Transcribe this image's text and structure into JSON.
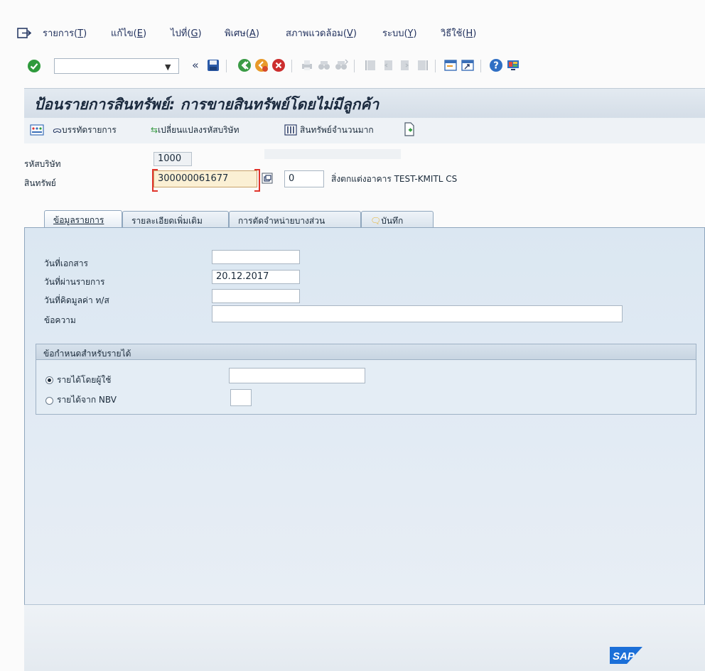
{
  "menu": {
    "items": [
      {
        "label": "รายการ(",
        "key": "T",
        "tail": ")"
      },
      {
        "label": "แก้ไข(",
        "key": "E",
        "tail": ")"
      },
      {
        "label": "ไปที่(",
        "key": "G",
        "tail": ")"
      },
      {
        "label": "พิเศษ(",
        "key": "A",
        "tail": ")"
      },
      {
        "label": "สภาพแวดล้อม(",
        "key": "V",
        "tail": ")"
      },
      {
        "label": "ระบบ(",
        "key": "Y",
        "tail": ")"
      },
      {
        "label": "วิธีใช้(",
        "key": "H",
        "tail": ")"
      }
    ]
  },
  "toolbar": {
    "command_field": "",
    "back_glyph": "«",
    "icons": [
      "save-icon",
      "back-icon",
      "exit-icon",
      "cancel-icon",
      "print-icon",
      "find-icon",
      "find-next-icon",
      "first-page-icon",
      "previous-page-icon",
      "next-page-icon",
      "last-page-icon",
      "create-session-icon",
      "shortcut-icon",
      "help-icon",
      "customize-layout-icon"
    ]
  },
  "title": "ป้อนรายการสินทรัพย์: การขายสินทรัพย์โดยไม่มีลูกค้า",
  "appbar": {
    "post_label": "บรรทัดรายการ",
    "change_company_label": "เปลี่ยนแปลงรหัสบริษัท",
    "mass_assets_label": "สินทรัพย์จำนวนมาก"
  },
  "header": {
    "company_code_label": "รหัสบริษัท",
    "company_code_value": "1000",
    "asset_label": "สินทรัพย์",
    "asset_value": "300000061677",
    "sub_number_value": "0",
    "asset_description": "สิ่งตกแต่งอาคาร TEST-KMITL CS"
  },
  "tabs": [
    {
      "label": "ข้อมูลรายการ",
      "active": true
    },
    {
      "label": "รายละเอียดเพิ่มเติม",
      "active": false
    },
    {
      "label": "การตัดจำหน่ายบางส่วน",
      "active": false
    },
    {
      "label": "บันทึก",
      "active": false
    }
  ],
  "form": {
    "document_date_label": "วันที่เอกสาร",
    "document_date_value": "",
    "posting_date_label": "วันที่ผ่านรายการ",
    "posting_date_value": "20.12.2017",
    "value_date_label": "วันที่คิดมูลค่า ท/ส",
    "value_date_value": "",
    "text_label": "ข้อความ",
    "text_value": ""
  },
  "revenue_group": {
    "title": "ข้อกำหนดสำหรับรายได้",
    "manual_label": "รายได้โดยผู้ใช้",
    "manual_selected": true,
    "manual_value": "",
    "nbv_label": "รายได้จาก NBV",
    "nbv_selected": false,
    "nbv_value": ""
  },
  "footer": {
    "logo_text": "SAP"
  },
  "colors": {
    "accent": "#1f3a66",
    "sap_blue": "#1b6fd8",
    "required_marker": "#e0342b",
    "asset_field_bg": "#fbf0d4",
    "ok_green": "#2e9a3c"
  }
}
